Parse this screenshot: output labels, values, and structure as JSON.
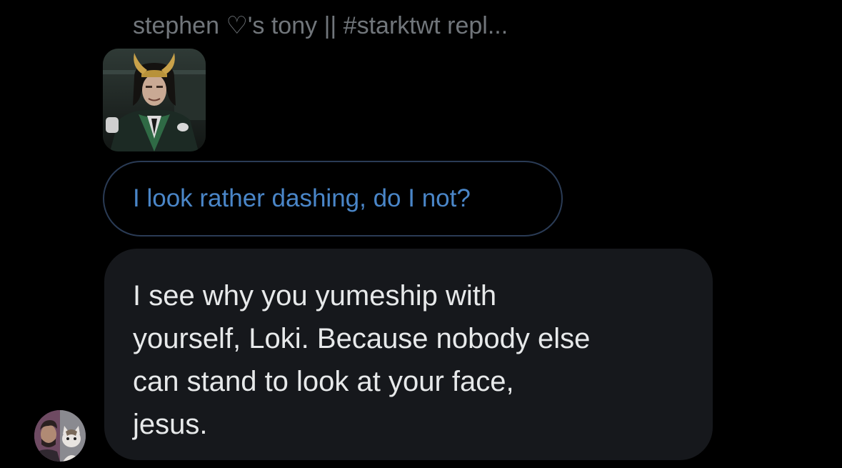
{
  "quoted_tweet": {
    "author_display": "stephen ♡'s tony || #starktwt repl...",
    "image_icon": "quoted-photo-icon"
  },
  "reply": {
    "quoted_text": "I look rather dashing, do I not?"
  },
  "message": {
    "lines": [
      "I see why you yumeship with",
      "yourself, Loki. Because nobody else",
      "can stand to look at your face,",
      "jesus."
    ]
  },
  "sender": {
    "avatar_icon": "sender-avatar-icon"
  },
  "colors": {
    "background": "#000000",
    "muted_text": "#71767b",
    "accent_blue": "#4a86c8",
    "pill_border": "#2a3b55",
    "bubble": "#16181c",
    "message_text": "#e7e9ea"
  }
}
